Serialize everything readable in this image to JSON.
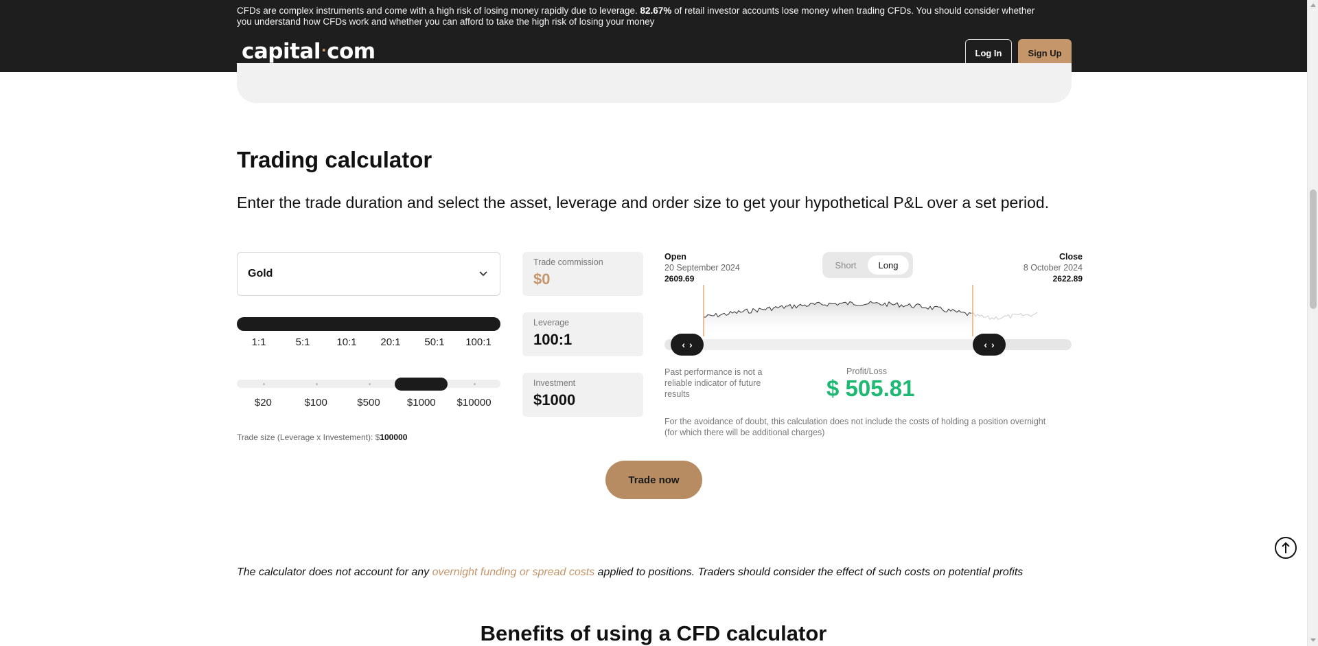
{
  "banner": {
    "risk_pre": "CFDs are complex instruments and come with a high risk of losing money rapidly due to leverage. ",
    "risk_bold": "82.67%",
    "risk_post": " of retail investor accounts lose money when trading CFDs. You should consider whether you understand how CFDs work and whether you can afford to take the high risk of losing your money",
    "logo_left": "capital",
    "logo_dot": "·",
    "logo_right": "com",
    "login_label": "Log In",
    "signup_label": "Sign Up"
  },
  "calculator": {
    "title": "Trading calculator",
    "subtitle": "Enter the trade duration and select the asset, leverage and order size to get your hypothetical P&L over a set period.",
    "asset_selected": "Gold",
    "leverage_options": [
      "1:1",
      "5:1",
      "10:1",
      "20:1",
      "50:1",
      "100:1"
    ],
    "investment_options": [
      "$20",
      "$100",
      "$500",
      "$1000",
      "$10000"
    ],
    "selected_leverage_index": 5,
    "selected_investment_index": 3,
    "trade_size_label": "Trade size (Leverage x Investement): $",
    "trade_size_value": "100000",
    "commission_label": "Trade commission",
    "commission_value": "$0",
    "leverage_label": "Leverage",
    "leverage_value": "100:1",
    "investment_label": "Investment",
    "investment_value": "$1000",
    "open_label": "Open",
    "open_date": "20 September 2024",
    "open_price": "2609.69",
    "close_label": "Close",
    "close_date": "8 October 2024",
    "close_price": "2622.89",
    "direction_short": "Short",
    "direction_long": "Long",
    "direction_selected": "Long",
    "past_performance": "Past performance is not a reliable indicator of future results",
    "pl_label": "Profit/Loss",
    "pl_value": "$ 505.81",
    "doubt_note": "For the avoidance of doubt, this calculation does not include the costs of holding a position overnight (for which there will be additional charges)",
    "trade_now_label": "Trade now"
  },
  "note": {
    "pre": "The calculator does not account for any ",
    "link": "overnight funding or spread costs",
    "post": " applied to positions. Traders should consider the effect of such costs on potential profits"
  },
  "benefits_heading": "Benefits of using a CFD calculator",
  "colors": {
    "accent": "#c4966a",
    "profit": "#1db871",
    "dark": "#1b1b1b",
    "range_marker": "#e07b2a"
  }
}
